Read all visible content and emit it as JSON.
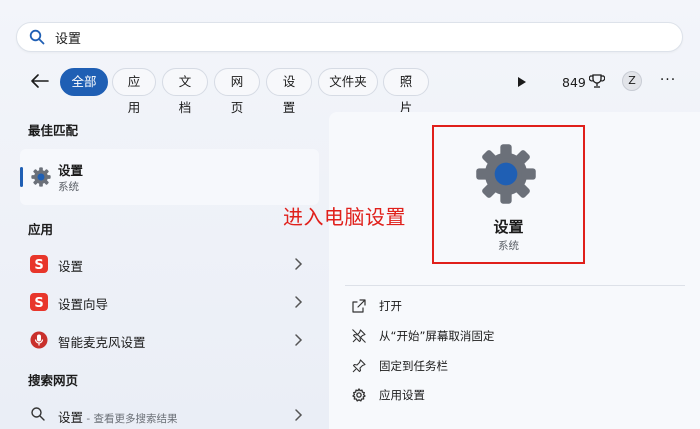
{
  "search": {
    "query": "设置",
    "icon": "search-icon"
  },
  "filters": {
    "back_icon": "arrow-left-icon",
    "chips": [
      "全部",
      "应用",
      "文档",
      "网页",
      "设置",
      "文件夹",
      "照片"
    ],
    "active_index": 0,
    "points": "849",
    "avatar": "Z",
    "more": "···"
  },
  "left": {
    "best_match_title": "最佳匹配",
    "best_match": {
      "name": "设置",
      "sub": "系统",
      "icon": "gear-icon"
    },
    "apps_title": "应用",
    "apps": [
      {
        "name": "设置",
        "icon": "sogou-icon"
      },
      {
        "name": "设置向导",
        "icon": "sogou-icon"
      },
      {
        "name": "智能麦克风设置",
        "icon": "mic-settings-icon"
      }
    ],
    "web_title": "搜索网页",
    "web": {
      "name": "设置",
      "hint": " - 查看更多搜索结果"
    }
  },
  "preview": {
    "name": "设置",
    "sub": "系统",
    "annotation": "进入电脑设置",
    "actions": [
      {
        "label": "打开",
        "icon": "open-icon"
      },
      {
        "label": "从“开始”屏幕取消固定",
        "icon": "unpin-icon"
      },
      {
        "label": "固定到任务栏",
        "icon": "pin-icon"
      },
      {
        "label": "应用设置",
        "icon": "gear-icon"
      }
    ]
  },
  "colors": {
    "accent": "#1f5fb4",
    "annotation": "#e0201b",
    "sogou": "#e8362b"
  }
}
